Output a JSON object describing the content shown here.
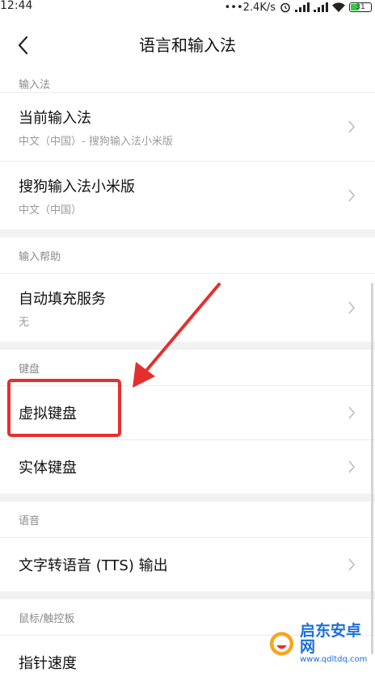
{
  "status_bar": {
    "time": "12:44",
    "network_speed": "•••2.4K/s",
    "battery_level": "31"
  },
  "header": {
    "title": "语言和输入法",
    "back_icon": "chevron-left-icon"
  },
  "sections": [
    {
      "header": "输入法",
      "items": [
        {
          "title": "当前输入法",
          "subtitle": "中文（中国）- 搜狗输入法小米版"
        },
        {
          "title": "搜狗输入法小米版",
          "subtitle": "中文（中国）"
        }
      ]
    },
    {
      "header": "输入帮助",
      "items": [
        {
          "title": "自动填充服务",
          "subtitle": "无"
        }
      ]
    },
    {
      "header": "键盘",
      "items": [
        {
          "title": "虚拟键盘"
        },
        {
          "title": "实体键盘"
        }
      ]
    },
    {
      "header": "语音",
      "items": [
        {
          "title": "文字转语音 (TTS) 输出"
        }
      ]
    },
    {
      "header": "鼠标/触控板",
      "items": [
        {
          "title": "指针速度"
        }
      ]
    }
  ],
  "annotation": {
    "color": "#e52f2f"
  },
  "watermark": {
    "title": "启东安卓网",
    "url": "www.qdltdq.com"
  }
}
